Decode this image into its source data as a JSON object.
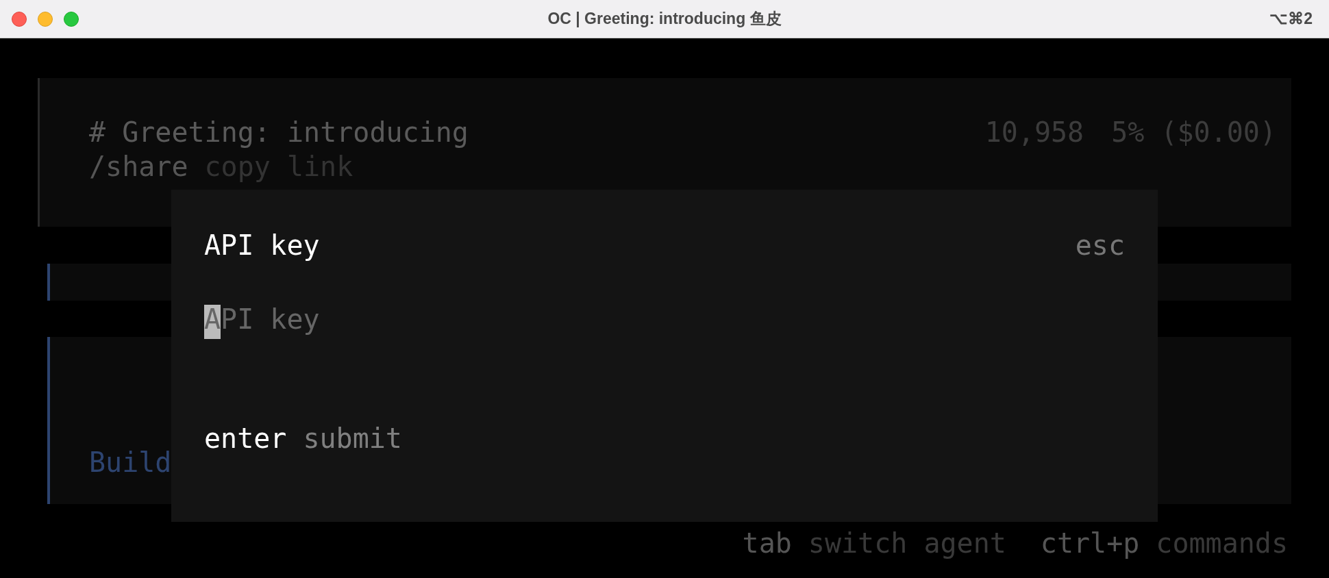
{
  "window": {
    "title": "OC | Greeting: introducing 鱼皮",
    "shortcut": "⌥⌘2"
  },
  "session": {
    "title": "# Greeting: introducing",
    "tokens": "10,958",
    "usage": "5% ($0.00)",
    "share_command": "/share",
    "share_hint": "copy link"
  },
  "prompt": {
    "text": "Build"
  },
  "dialog": {
    "title": "API key",
    "close_hint": "esc",
    "field": {
      "placeholder": "API key"
    },
    "submit_key": "enter",
    "submit_label": "submit"
  },
  "footer": [
    {
      "key": "tab",
      "label": "switch agent"
    },
    {
      "key": "ctrl+p",
      "label": "commands"
    }
  ]
}
